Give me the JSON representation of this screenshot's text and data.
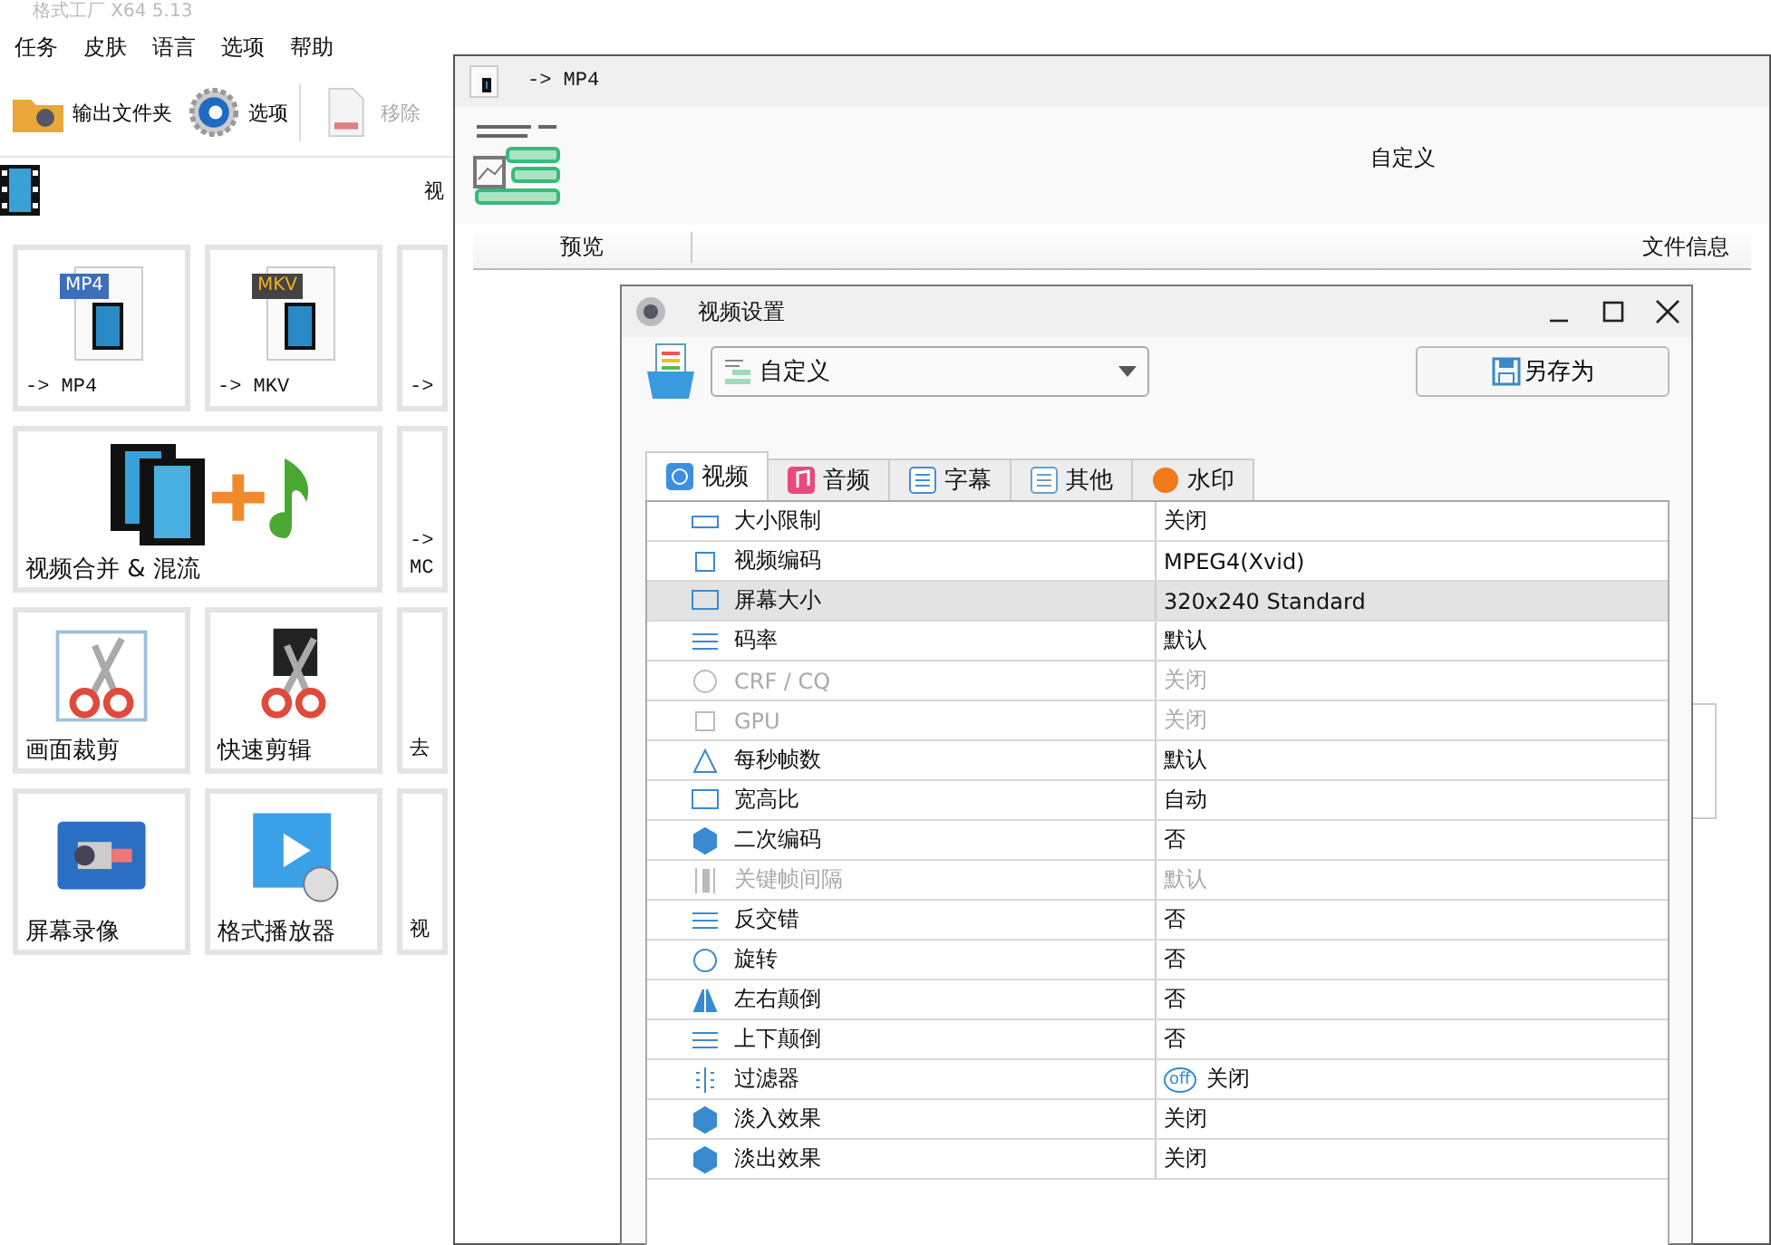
{
  "main_window": {
    "title": "格式工厂  X64 5.13",
    "menu": [
      "任务",
      "皮肤",
      "语言",
      "选项",
      "帮助"
    ],
    "toolbar": [
      {
        "label": "输出文件夹",
        "disabled": false
      },
      {
        "label": "选项",
        "disabled": false
      },
      {
        "label": "移除",
        "disabled": true
      }
    ],
    "category_label": "视",
    "tiles": [
      {
        "label": "-> MP4",
        "badge": "MP4",
        "wide": false,
        "cut": false
      },
      {
        "label": "-> MKV",
        "badge": "MKV",
        "wide": false,
        "cut": false
      },
      {
        "label": "->",
        "wide": false,
        "cut": true
      },
      {
        "label": "视频合并 & 混流",
        "wide": true,
        "cut": false
      },
      {
        "label": "-> MC",
        "wide": false,
        "cut": true
      },
      {
        "label": "画面裁剪",
        "wide": false,
        "cut": false
      },
      {
        "label": "快速剪辑",
        "wide": false,
        "cut": false
      },
      {
        "label": "去",
        "wide": false,
        "cut": true
      },
      {
        "label": "屏幕录像",
        "wide": false,
        "cut": false
      },
      {
        "label": "格式播放器",
        "wide": false,
        "cut": false
      },
      {
        "label": "视",
        "wide": false,
        "cut": true
      }
    ]
  },
  "convert_window": {
    "title": "-> MP4",
    "preset": "自定义",
    "columns": [
      "预览",
      "文件信息"
    ]
  },
  "dialog": {
    "title": "视频设置",
    "preset": "自定义",
    "save_as": "另存为",
    "tabs": [
      {
        "label": "视频",
        "selected": true
      },
      {
        "label": "音频",
        "selected": false
      },
      {
        "label": "字幕",
        "selected": false
      },
      {
        "label": "其他",
        "selected": false
      },
      {
        "label": "水印",
        "selected": false
      }
    ],
    "rows": [
      {
        "name": "大小限制",
        "value": "关闭",
        "disabled": false,
        "selected": false
      },
      {
        "name": "视频编码",
        "value": "MPEG4(Xvid)",
        "disabled": false,
        "selected": false
      },
      {
        "name": "屏幕大小",
        "value": "320x240  Standard",
        "disabled": false,
        "selected": true
      },
      {
        "name": "码率",
        "value": "默认",
        "disabled": false,
        "selected": false
      },
      {
        "name": "CRF / CQ",
        "value": "关闭",
        "disabled": true,
        "selected": false
      },
      {
        "name": "GPU",
        "value": "关闭",
        "disabled": true,
        "selected": false
      },
      {
        "name": "每秒帧数",
        "value": "默认",
        "disabled": false,
        "selected": false
      },
      {
        "name": "宽高比",
        "value": "自动",
        "disabled": false,
        "selected": false
      },
      {
        "name": "二次编码",
        "value": "否",
        "disabled": false,
        "selected": false
      },
      {
        "name": "关键帧间隔",
        "value": "默认",
        "disabled": true,
        "selected": false
      },
      {
        "name": "反交错",
        "value": "否",
        "disabled": false,
        "selected": false
      },
      {
        "name": "旋转",
        "value": "否",
        "disabled": false,
        "selected": false
      },
      {
        "name": "左右颠倒",
        "value": "否",
        "disabled": false,
        "selected": false
      },
      {
        "name": "上下颠倒",
        "value": "否",
        "disabled": false,
        "selected": false
      },
      {
        "name": "过滤器",
        "value": "关闭",
        "value_badge": "off",
        "disabled": false,
        "selected": false
      },
      {
        "name": "淡入效果",
        "value": "关闭",
        "disabled": false,
        "selected": false
      },
      {
        "name": "淡出效果",
        "value": "关闭",
        "disabled": false,
        "selected": false
      }
    ]
  }
}
